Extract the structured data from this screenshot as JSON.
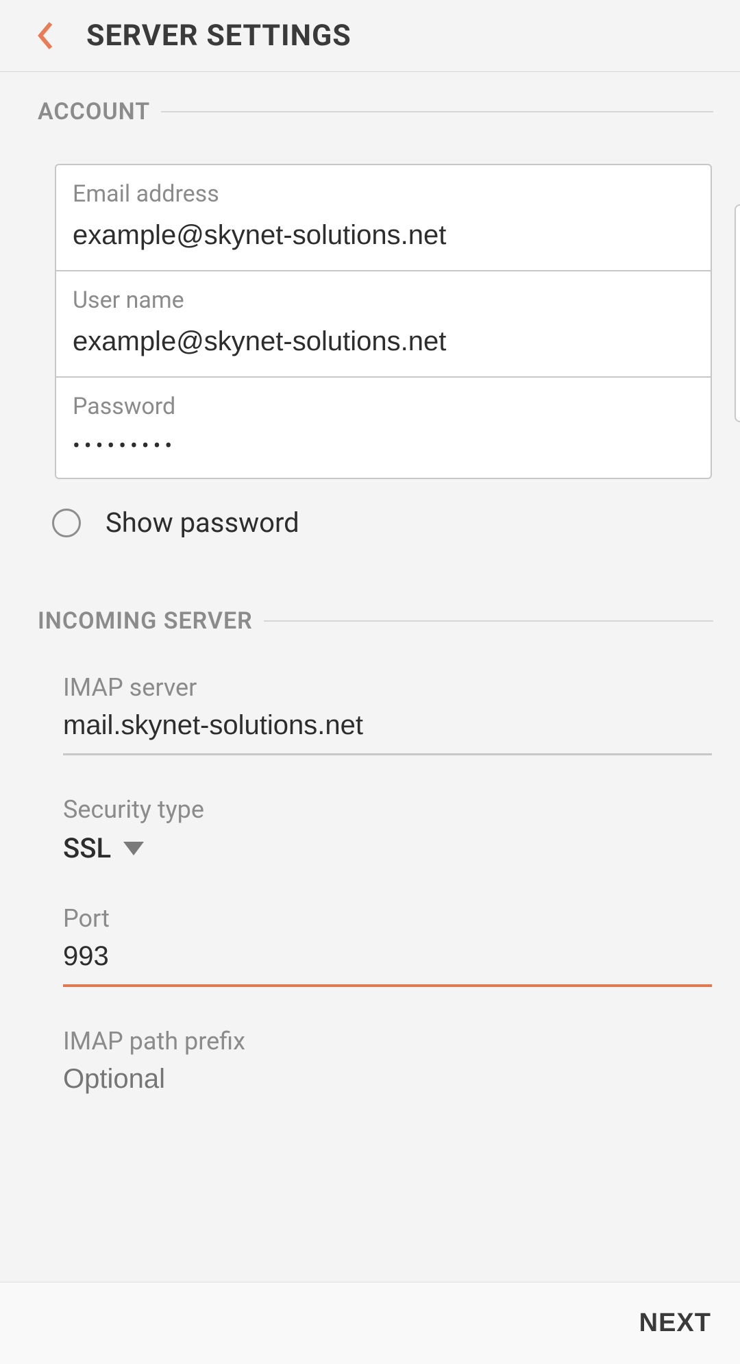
{
  "header": {
    "title": "SERVER SETTINGS"
  },
  "sections": {
    "account": {
      "heading": "ACCOUNT",
      "email": {
        "label": "Email address",
        "value": "example@skynet-solutions.net"
      },
      "username": {
        "label": "User name",
        "value": "example@skynet-solutions.net"
      },
      "password": {
        "label": "Password",
        "value": "•••••••••"
      },
      "show_password_label": "Show password"
    },
    "incoming": {
      "heading": "INCOMING SERVER",
      "imap_server": {
        "label": "IMAP server",
        "value": "mail.skynet-solutions.net"
      },
      "security": {
        "label": "Security type",
        "value": "SSL"
      },
      "port": {
        "label": "Port",
        "value": "993"
      },
      "path_prefix": {
        "label": "IMAP path prefix",
        "placeholder": "Optional"
      }
    }
  },
  "footer": {
    "next_label": "NEXT"
  },
  "colors": {
    "accent": "#e07a52",
    "label_gray": "#8b8b8b",
    "text_dark": "#2d2d2d",
    "background": "#f4f4f4"
  }
}
